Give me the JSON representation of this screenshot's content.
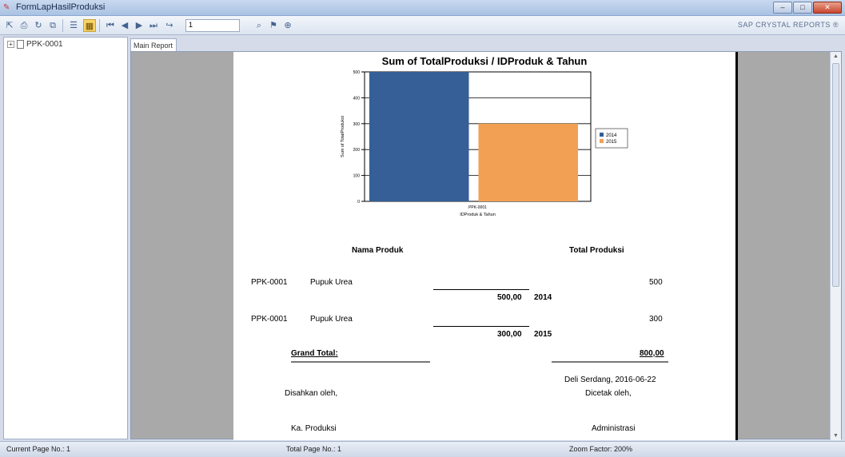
{
  "window": {
    "title": "FormLapHasilProduksi"
  },
  "toolbar": {
    "page_value": "1",
    "brand": "SAP CRYSTAL REPORTS ®"
  },
  "tree": {
    "item": "PPK-0001"
  },
  "tab": {
    "label": "Main Report"
  },
  "chart_data": {
    "type": "bar",
    "title": "Sum of TotalProduksi / IDProduk & Tahun",
    "xlabel": "IDProduk & Tahun",
    "ylabel": "Sum of TotalProduksi",
    "categories": [
      "PPK-0001"
    ],
    "series": [
      {
        "name": "2014",
        "values": [
          500
        ],
        "color": "#355f96"
      },
      {
        "name": "2015",
        "values": [
          300
        ],
        "color": "#f2a054"
      }
    ],
    "ylim": [
      0,
      500
    ],
    "yticks": [
      "0",
      "100",
      "200",
      "300",
      "400",
      "500"
    ],
    "grid": true,
    "legend": "right"
  },
  "report": {
    "col_nama": "Nama Produk",
    "col_total": "Total Produksi",
    "rows": [
      {
        "id": "PPK-0001",
        "name": "Pupuk Urea",
        "value": "500",
        "subtotal": "500,00",
        "year": "2014"
      },
      {
        "id": "PPK-0001",
        "name": "Pupuk Urea",
        "value": "300",
        "subtotal": "300,00",
        "year": "2015"
      }
    ],
    "grand_label": "Grand Total:",
    "grand_value": "800,00",
    "place_date": "Deli Serdang,  2016-06-22",
    "disahkan": "Disahkan oleh,",
    "dicetak": "Dicetak oleh,",
    "ka_produksi": "Ka. Produksi",
    "administrasi": "Administrasi"
  },
  "status": {
    "current_page": "Current Page No.: 1",
    "total_page": "Total Page No.: 1",
    "zoom": "Zoom Factor: 200%"
  }
}
